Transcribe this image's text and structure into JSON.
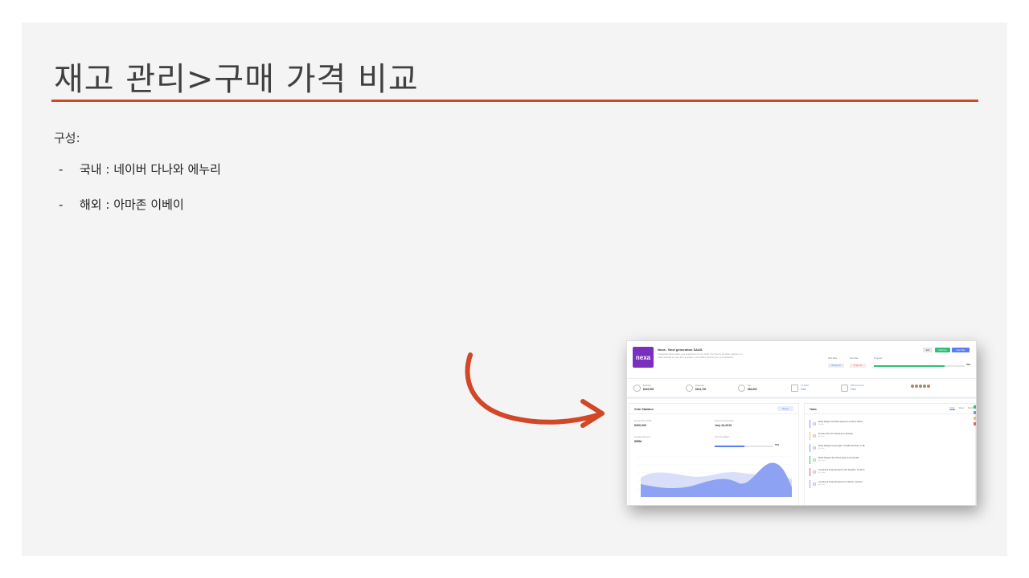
{
  "slide": {
    "title": "재고 관리>구매 가격 비교",
    "config_label": "구성:",
    "bullets": [
      {
        "dash": "-",
        "text": "국내 : 네이버 다나와 에누리"
      },
      {
        "dash": "-",
        "text": "해외 : 아마존 이베이"
      }
    ],
    "colors": {
      "accent": "#d24726",
      "background": "#f4f4f4",
      "title": "#404040"
    }
  },
  "thumbnail": {
    "logo_text": "nexa",
    "title": "Nexa - Next generation SAAS",
    "description": "CodeIgniter Nexa makes your experience on your cloud. You need to be either a lawyer or a rocket scientist to move from a problem. The world's gone for your, your dividends.",
    "buttons": [
      "Edit",
      "Add User",
      "New Task"
    ],
    "meta": {
      "start_date_label": "Start Date",
      "start_date": "20 April, 20",
      "due_date_label": "Due Date",
      "due_date": "07 Apr, 21",
      "progress_label": "Progress",
      "progress_pct": "78%"
    },
    "stats": [
      {
        "icon": "earnings-icon",
        "label": "Earnings",
        "value": "$249,500"
      },
      {
        "icon": "expenses-icon",
        "label": "Expenses",
        "value": "$164,700"
      },
      {
        "icon": "net-icon",
        "label": "Net",
        "value": "$84,800"
      },
      {
        "icon": "tasks-icon",
        "label": "73 Tasks",
        "value": "View"
      },
      {
        "icon": "comments-icon",
        "label": "648 Comments",
        "value": "View"
      }
    ],
    "order_stats": {
      "title": "Order Statistics",
      "report_button": "Report",
      "annual_label": "Annual Taxes 2019",
      "annual_value": "$400,000",
      "finance_label": "Finance Review Date",
      "finance_value": "July 24,2019",
      "revenue_label": "Average Revenue",
      "revenue_value": "$55M",
      "sales_label": "Revenue Margin",
      "sales_pct": "55%"
    },
    "tasks": {
      "title": "Tasks",
      "tabs": [
        "Today",
        "Week",
        "Month"
      ],
      "items": [
        {
          "text": "Make Widget And Pitch Agents as Amazon Works",
          "sub": "By Bob",
          "color": "#7b8ff2"
        },
        {
          "text": "Prepare Docs For Meeting On Monday",
          "sub": "By Sean",
          "color": "#f2c14e"
        },
        {
          "text": "Make Widgets Great Again. Uncalled Zombies is 3B",
          "sub": "By Sean",
          "color": "#7b8ff2"
        },
        {
          "text": "Make Widgets Sky Shock Again & Amsterdam",
          "sub": "By Carlos",
          "color": "#2fbf7a"
        },
        {
          "text": "Completed Financial Report with Deadline. Ad Runs",
          "sub": "By Carlos",
          "color": "#e85b6a"
        },
        {
          "text": "Completed Financial Report for Initiative. Ad Runs",
          "sub": "By Carlos",
          "color": "#b98ff2"
        }
      ]
    }
  }
}
